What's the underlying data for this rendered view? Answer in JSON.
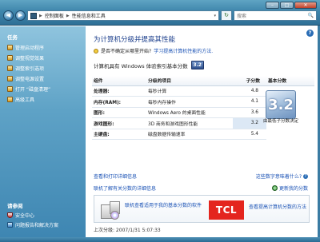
{
  "window": {
    "min_icon": "minimize-icon",
    "max_icon": "maximize-icon",
    "close_icon": "close-icon",
    "min_glyph": "–",
    "max_glyph": "□",
    "close_glyph": "✕"
  },
  "nav": {
    "back_glyph": "◀",
    "forward_glyph": "▶",
    "refresh_glyph": "↻"
  },
  "address": {
    "root_sep": "▶",
    "crumb1": "控制面板",
    "sep": "▶",
    "crumb2": "性能信息和工具",
    "dropdown": "▾"
  },
  "search": {
    "placeholder": "搜索",
    "icon_glyph": "🔍"
  },
  "sidebar": {
    "heading_tasks": "任务",
    "items": [
      {
        "label": "管理启动程序"
      },
      {
        "label": "调整视觉效果"
      },
      {
        "label": "调整索引选项"
      },
      {
        "label": "调整电源设置"
      },
      {
        "label": "打开 “磁盘清理”"
      },
      {
        "label": "高级工具"
      }
    ],
    "heading_see_also": "请参阅",
    "see_also": [
      {
        "label": "安全中心"
      },
      {
        "label": "问题报告和解决方案"
      }
    ]
  },
  "main": {
    "help_glyph": "?",
    "title": "为计算机分级并提高其性能",
    "why_prefix": "是否不确定从哪里开始?",
    "why_link": "学习提高计算机性能的方法.",
    "rating_text": "计算机具有 Windows 体验索引基本分数",
    "rating_badge": "3.2",
    "table": {
      "headers": [
        "组件",
        "分级的项目",
        "子分数",
        "基本分数"
      ],
      "rows": [
        {
          "component": "处理器:",
          "item": "每秒计算",
          "sub": "4.8"
        },
        {
          "component": "内存(RAM):",
          "item": "每秒内存操作",
          "sub": "4.1"
        },
        {
          "component": "图形:",
          "item": "Windows Aero 的桌面性能",
          "sub": "3.6"
        },
        {
          "component": "游戏图形:",
          "item": "3D 商务和游戏图形性能",
          "sub": "3.2"
        },
        {
          "component": "主硬盘:",
          "item": "磁盘数据传输速率",
          "sub": "5.4"
        }
      ]
    },
    "base_score": "3.2",
    "base_caption": "由最低子分数决定",
    "detail_link": "查看和打印详细信息",
    "sample_link": "联机了解有关分数的详细信息",
    "what_link": "这些数字意味着什么?",
    "update_link": "更新我的分数",
    "promo": {
      "text_line1": "联机查看适用于我的基本分数的软件",
      "brand": "TCL",
      "text2": "查看提高计算机分数的方法"
    },
    "last_update": "上次分级: 2007/1/31 5:07:33"
  }
}
